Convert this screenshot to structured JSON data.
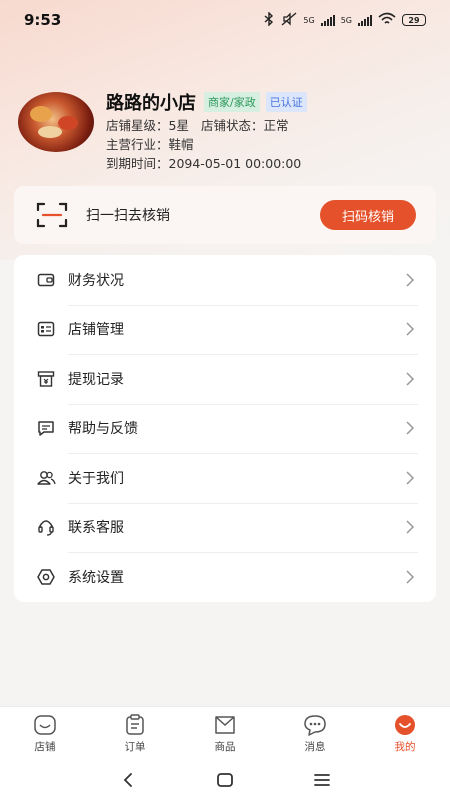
{
  "status_bar": {
    "time": "9:53",
    "network_1": "5G",
    "network_2": "5G",
    "battery": "29"
  },
  "profile": {
    "shop_name": "路路的小店",
    "tags": [
      "商家/家政",
      "已认证"
    ],
    "star_level": "店铺星级：5星",
    "shop_status": "店铺状态：正常",
    "industry": "主营行业：鞋帽",
    "expiry": "到期时间：2094-05-01 00:00:00"
  },
  "scan": {
    "text": "扫一扫去核销",
    "button_label": "扫码核销"
  },
  "menu": {
    "items": [
      {
        "label": "财务状况",
        "icon": "wallet-icon"
      },
      {
        "label": "店铺管理",
        "icon": "shop-manage-icon"
      },
      {
        "label": "提现记录",
        "icon": "withdraw-icon"
      },
      {
        "label": "帮助与反馈",
        "icon": "feedback-icon"
      },
      {
        "label": "关于我们",
        "icon": "users-icon"
      },
      {
        "label": "联系客服",
        "icon": "headset-icon"
      },
      {
        "label": "系统设置",
        "icon": "settings-icon"
      }
    ]
  },
  "tabbar": {
    "tabs": [
      {
        "label": "店铺",
        "icon": "shop-tab-icon",
        "active": false
      },
      {
        "label": "订单",
        "icon": "order-tab-icon",
        "active": false
      },
      {
        "label": "商品",
        "icon": "product-tab-icon",
        "active": false
      },
      {
        "label": "消息",
        "icon": "message-tab-icon",
        "active": false
      },
      {
        "label": "我的",
        "icon": "mine-tab-icon",
        "active": true
      }
    ]
  },
  "colors": {
    "accent": "#e4512a",
    "tag_green_text": "#2e9a5c",
    "tag_blue_text": "#4874e0"
  }
}
